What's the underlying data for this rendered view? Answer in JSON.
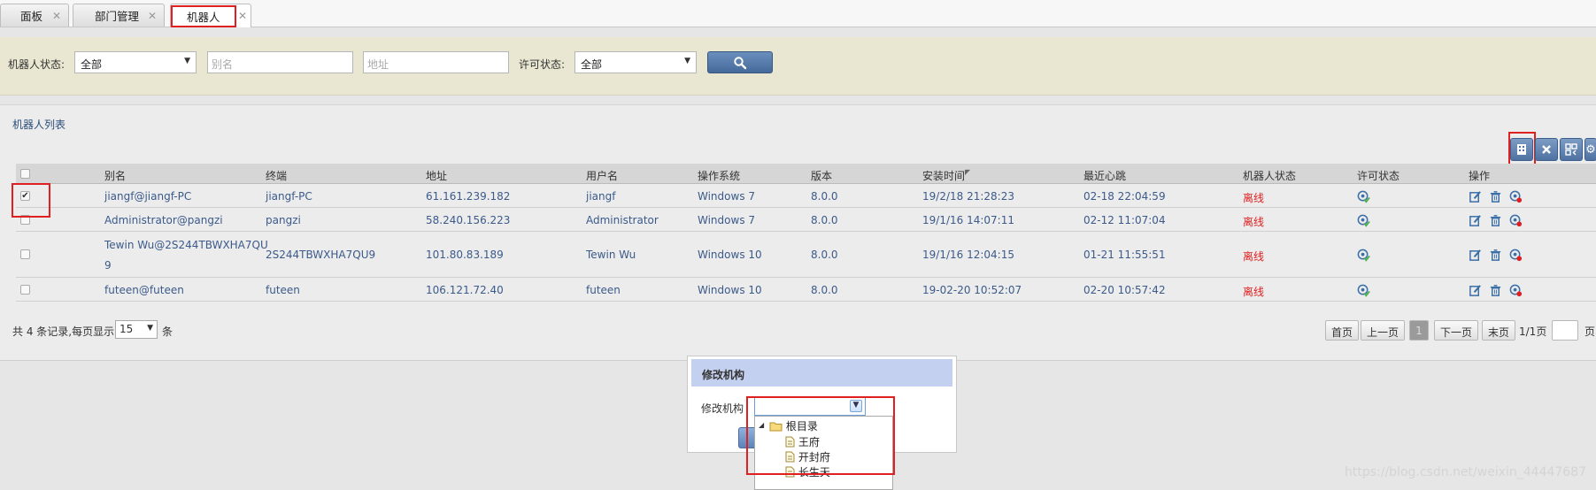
{
  "tabs": [
    {
      "label": "面板"
    },
    {
      "label": "部门管理"
    },
    {
      "label": "机器人"
    }
  ],
  "search": {
    "robot_status_label": "机器人状态:",
    "robot_status_value": "全部",
    "alias_placeholder": "别名",
    "address_placeholder": "地址",
    "license_status_label": "许可状态:",
    "license_status_value": "全部"
  },
  "list": {
    "title": "机器人列表",
    "columns": [
      "别名",
      "终端",
      "地址",
      "用户名",
      "操作系统",
      "版本",
      "安装时间",
      "最近心跳",
      "机器人状态",
      "许可状态",
      "操作"
    ],
    "sort_mark": "◤",
    "rows": [
      {
        "checked": "✔",
        "alias": "jiangf@jiangf-PC",
        "alias2": "",
        "terminal": "jiangf-PC",
        "address": "61.161.239.182",
        "username": "jiangf",
        "os": "Windows 7",
        "version": "8.0.0",
        "install_time": "19/2/18 21:28:23",
        "heartbeat": "02-18 22:04:59",
        "status": "离线"
      },
      {
        "checked": "",
        "alias": "Administrator@pangzi",
        "alias2": "",
        "terminal": "pangzi",
        "address": "58.240.156.223",
        "username": "Administrator",
        "os": "Windows 7",
        "version": "8.0.0",
        "install_time": "19/1/16 14:07:11",
        "heartbeat": "02-12 11:07:04",
        "status": "离线"
      },
      {
        "checked": "",
        "alias": "Tewin Wu@2S244TBWXHA7QU",
        "alias2": "9",
        "terminal": "2S244TBWXHA7QU9",
        "address": "101.80.83.189",
        "username": "Tewin Wu",
        "os": "Windows 10",
        "version": "8.0.0",
        "install_time": "19/1/16 12:04:15",
        "heartbeat": "01-21 11:55:51",
        "status": "离线"
      },
      {
        "checked": "",
        "alias": "futeen@futeen",
        "alias2": "",
        "terminal": "futeen",
        "address": "106.121.72.40",
        "username": "futeen",
        "os": "Windows 10",
        "version": "8.0.0",
        "install_time": "19-02-20 10:52:07",
        "heartbeat": "02-20 10:57:42",
        "status": "离线"
      }
    ]
  },
  "footer": {
    "records_text": "共 4 条记录,每页显示",
    "page_size": "15",
    "unit": "条",
    "first": "首页",
    "prev": "上一页",
    "current_page": "1",
    "next": "下一页",
    "last": "末页",
    "page_info": "1/1页",
    "page_suffix": "页"
  },
  "dialog": {
    "title": "修改机构",
    "field_label": "修改机构",
    "tree_root": "根目录",
    "tree_children": [
      "王府",
      "开封府",
      "长生天"
    ]
  },
  "watermark": "https://blog.csdn.net/weixin_44447687",
  "colors": {
    "offline": "#e02020",
    "highlight": "#e02020",
    "link": "#3b5a8a"
  }
}
